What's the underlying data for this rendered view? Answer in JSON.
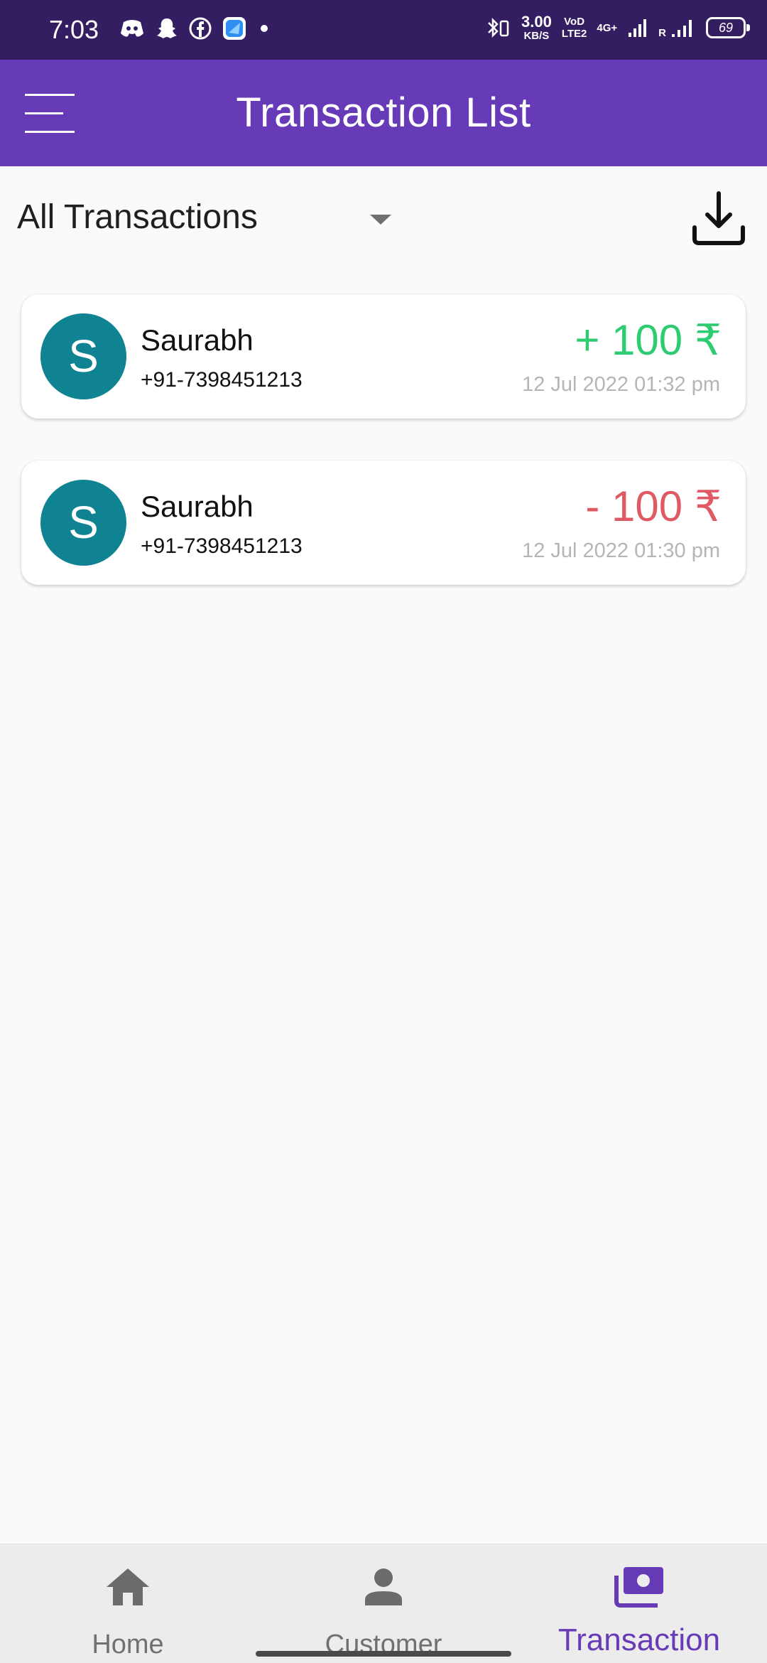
{
  "status_bar": {
    "time": "7:03",
    "net_speed_value": "3.00",
    "net_speed_unit": "KB/S",
    "volte_top": "VoD",
    "volte_bottom": "LTE2",
    "network_type": "4G+",
    "roaming": "R",
    "battery": "69",
    "icons": [
      "discord-icon",
      "snapchat-icon",
      "facebook-icon",
      "app-icon",
      "dot-icon",
      "bluetooth-icon",
      "signal-icon"
    ]
  },
  "app_bar": {
    "title": "Transaction List"
  },
  "filter": {
    "selected": "All Transactions"
  },
  "transactions": [
    {
      "avatar_letter": "S",
      "name": "Saurabh",
      "phone": "+91-7398451213",
      "amount": "+ 100 ₹",
      "type": "credit",
      "date": "12 Jul 2022 01:32 pm"
    },
    {
      "avatar_letter": "S",
      "name": "Saurabh",
      "phone": "+91-7398451213",
      "amount": "- 100 ₹",
      "type": "debit",
      "date": "12 Jul 2022 01:30 pm"
    }
  ],
  "bottom_nav": {
    "items": [
      {
        "label": "Home",
        "icon": "home-icon",
        "active": false
      },
      {
        "label": "Customer",
        "icon": "person-icon",
        "active": false
      },
      {
        "label": "Transaction",
        "icon": "payments-icon",
        "active": true
      }
    ]
  },
  "colors": {
    "status_bar": "#341e62",
    "primary": "#673ab7",
    "credit": "#2ecc71",
    "debit": "#e05a66",
    "avatar": "#0f8391",
    "date_text": "#b5b5b5"
  }
}
